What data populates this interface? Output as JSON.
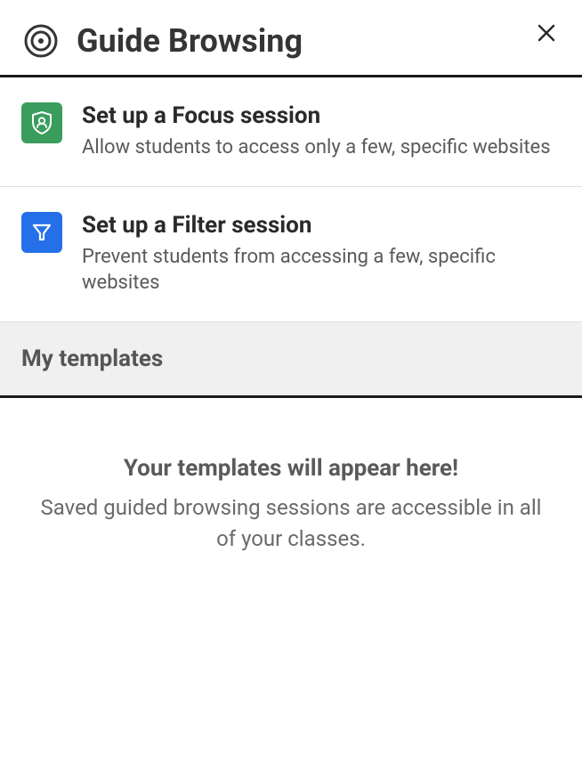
{
  "header": {
    "title": "Guide Browsing"
  },
  "options": {
    "focus": {
      "title": "Set up a Focus session",
      "description": "Allow students to access only a few, specific websites"
    },
    "filter": {
      "title": "Set up a Filter session",
      "description": "Prevent students from accessing a few, specific websites"
    }
  },
  "templates": {
    "section_title": "My templates",
    "empty_title": "Your templates will appear here!",
    "empty_description": "Saved guided browsing sessions are accessible in all of your classes."
  }
}
